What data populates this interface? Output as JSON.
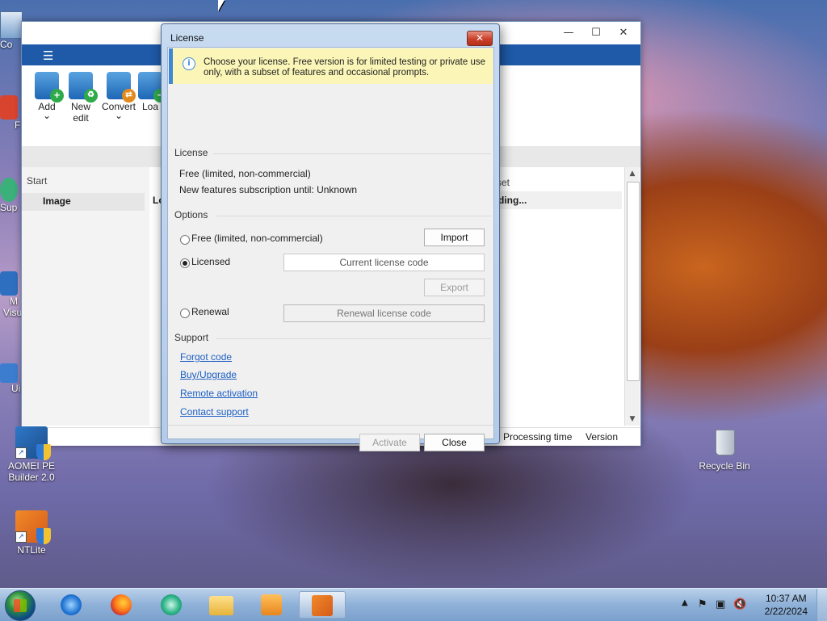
{
  "desktop": {
    "icons": [
      {
        "label": "AOMEI PE Builder 2.0"
      },
      {
        "label": "NTLite"
      },
      {
        "label": "Recycle Bin"
      }
    ],
    "edge_labels": [
      "Co",
      "F",
      "Sup",
      "M",
      "Visu",
      "Ui"
    ]
  },
  "app": {
    "ribbon": [
      {
        "label": "Add",
        "arrow": "⌄"
      },
      {
        "label": "New edit"
      },
      {
        "label": "Convert",
        "arrow": "⌄"
      },
      {
        "label": "Loa"
      }
    ],
    "left_pane": {
      "start": "Start",
      "image": "Image"
    },
    "column_lo": "Lo",
    "column_set": "set",
    "column_ding": "ding...",
    "status": {
      "processing_time": "Processing time",
      "version": "Version"
    }
  },
  "dialog": {
    "title": "License",
    "close_glyph": "✕",
    "info_text": "Choose your license. Free version is for limited testing or private use only, with a subset of features and occasional prompts.",
    "license_section": "License",
    "license_type": "Free (limited, non-commercial)",
    "subscription": "New features subscription until: Unknown",
    "options_section": "Options",
    "option_free": "Free (limited, non-commercial)",
    "option_licensed": "Licensed",
    "option_renewal": "Renewal",
    "import_button": "Import",
    "export_button": "Export",
    "current_license_placeholder": "Current license code",
    "renewal_license_placeholder": "Renewal license code",
    "support_section": "Support",
    "links": {
      "forgot": "Forgot code",
      "buy": "Buy/Upgrade",
      "remote": "Remote activation",
      "contact": "Contact support"
    },
    "activate_button": "Activate",
    "close_button": "Close",
    "selected_option": "licensed"
  },
  "taskbar": {
    "clock_time": "10:37 AM",
    "clock_date": "2/22/2024"
  }
}
